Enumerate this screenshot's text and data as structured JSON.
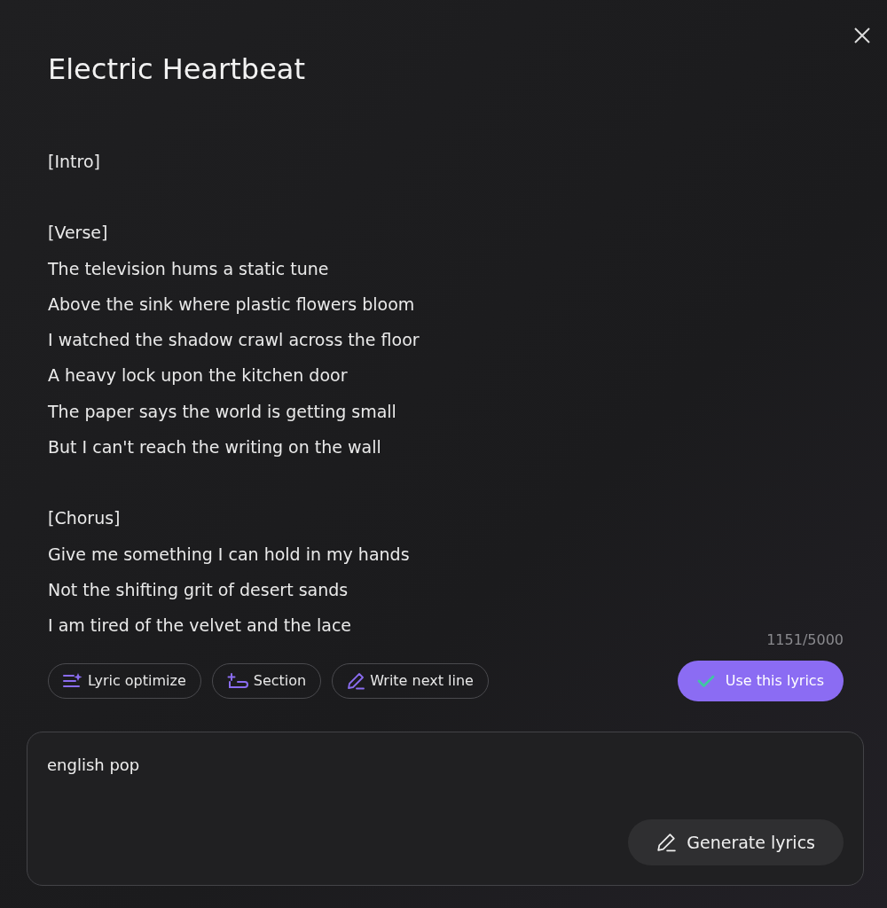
{
  "dialog": {
    "title": "Electric Heartbeat"
  },
  "lyrics": [
    [
      "[Intro]"
    ],
    [
      "[Verse]",
      "The television hums a static tune",
      "Above the sink where plastic flowers bloom",
      "I watched the shadow crawl across the floor",
      "A heavy lock upon the kitchen door",
      "The paper says the world is getting small",
      "But I can't reach the writing on the wall"
    ],
    [
      "[Chorus]",
      "Give me something I can hold in my hands",
      "Not the shifting grit of desert sands",
      "I am tired of the velvet and the lace"
    ]
  ],
  "counter": "1151/5000",
  "tools": [
    {
      "kind": "optimize",
      "label": "Lyric optimize"
    },
    {
      "kind": "section",
      "label": "Section"
    },
    {
      "kind": "write",
      "label": "Write next line"
    }
  ],
  "use_button": {
    "label": "Use this lyrics"
  },
  "prompt": {
    "value": "english pop"
  },
  "generate_button": {
    "label": "Generate lyrics"
  }
}
